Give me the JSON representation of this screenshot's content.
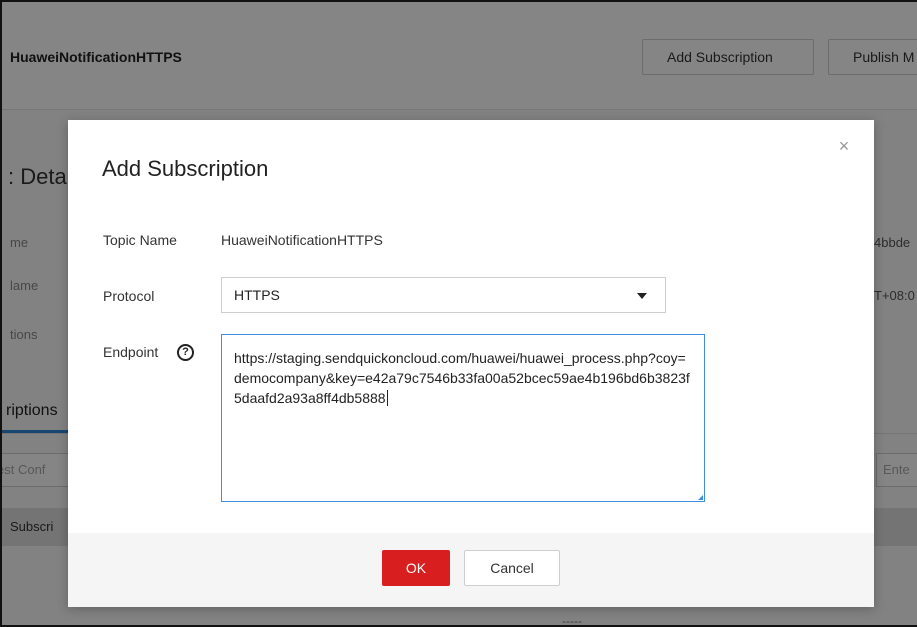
{
  "page": {
    "topic_title": "HuaweiNotificationHTTPS",
    "buttons": {
      "add_subscription": "Add Subscription",
      "publish_message": "Publish M"
    },
    "section_heading": ": Deta",
    "left_labels": [
      "me",
      "lame",
      "tions"
    ],
    "right_values": [
      "4bbde",
      "T+08:0"
    ],
    "tab_label": "riptions",
    "filter_left": "est Conf",
    "filter_right": "Ente",
    "table_header": "Subscri",
    "footer_fragment": "-----"
  },
  "dialog": {
    "title": "Add Subscription",
    "close_icon": "×",
    "fields": {
      "topic_name_label": "Topic Name",
      "topic_name_value": "HuaweiNotificationHTTPS",
      "protocol_label": "Protocol",
      "protocol_value": "HTTPS",
      "endpoint_label": "Endpoint",
      "endpoint_help_icon": "?",
      "endpoint_value": "https://staging.sendquickoncloud.com/huawei/huawei_process.php?coy=democompany&key=e42a79c7546b33fa00a52bcec59ae4b196bd6b3823f5daafd2a93a8ff4db5888"
    },
    "footer": {
      "ok_label": "OK",
      "cancel_label": "Cancel"
    }
  },
  "colors": {
    "accent_blue": "#2f86d6",
    "ok_red": "#d81e1e",
    "overlay": "rgba(0,0,0,0.48)"
  }
}
